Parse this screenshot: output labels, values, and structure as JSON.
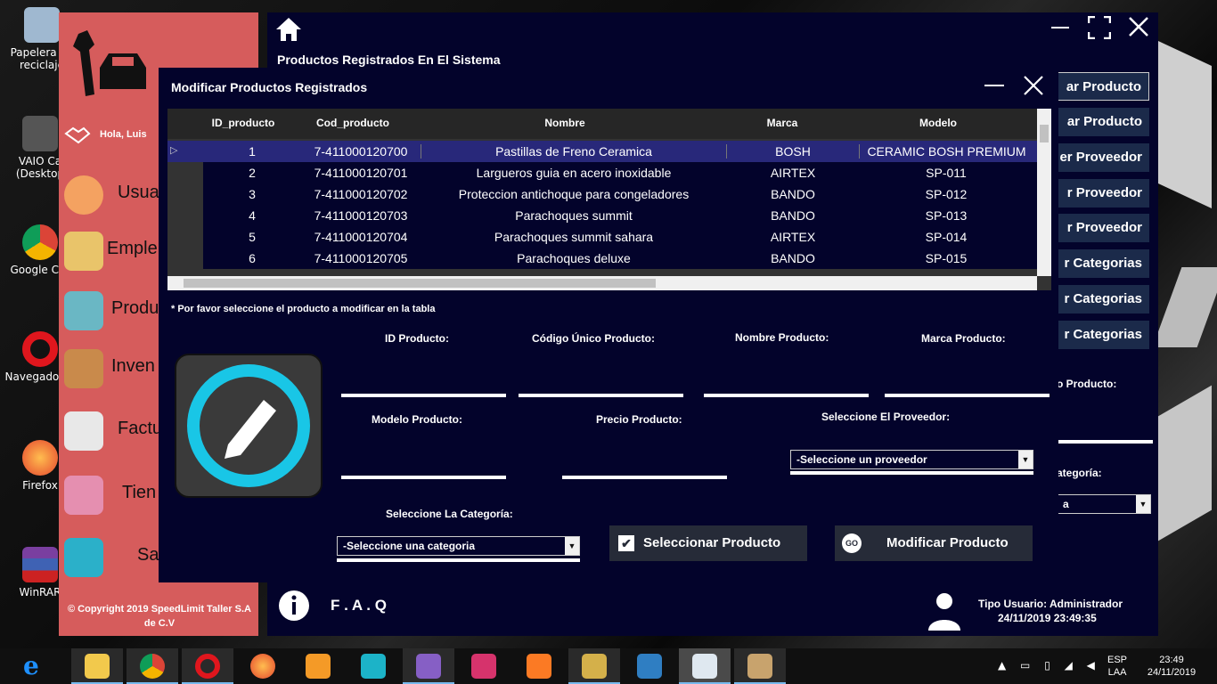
{
  "desktop_icons": [
    {
      "label": "Papelera de reciclaje",
      "icon": "recycle-bin-icon"
    },
    {
      "label": "VAIO Ca (Desktop",
      "icon": "vaio-laptop-icon"
    },
    {
      "label": "Google Chr",
      "icon": "chrome-icon"
    },
    {
      "label": "Navegador O",
      "icon": "opera-icon"
    },
    {
      "label": "Firefox",
      "icon": "firefox-icon"
    },
    {
      "label": "WinRAR",
      "icon": "winrar-icon"
    }
  ],
  "sidebar": {
    "greeting": "Hola, Luis",
    "items": [
      {
        "label": "Usua",
        "icon": "user-icon"
      },
      {
        "label": "Emple",
        "icon": "employee-badge-icon"
      },
      {
        "label": "Produ",
        "icon": "basket-icon"
      },
      {
        "label": "Inven",
        "icon": "box-icon"
      },
      {
        "label": "Factu",
        "icon": "cash-register-icon"
      },
      {
        "label": "Tien",
        "icon": "store-icon"
      },
      {
        "label": "Sa",
        "icon": "exit-icon"
      }
    ],
    "copyright": "© Copyright 2019 SpeedLimit Taller S.A de C.V"
  },
  "main": {
    "title": "Productos Registrados En El Sistema",
    "right_buttons": [
      "ar Producto",
      "ar Producto",
      "er Proveedor",
      "r Proveedor",
      "r Proveedor",
      "r Categorias",
      "r Categorias",
      "r Categorias"
    ],
    "partial_label_1": "o Producto:",
    "partial_label_2": "ategoría:",
    "partial_combo": "a",
    "faq": "F . A . Q",
    "user_type": "Tipo Usuario: Administrador",
    "datetime": "24/11/2019 23:49:35"
  },
  "dialog": {
    "title": "Modificar Productos Registrados",
    "columns": [
      "ID_producto",
      "Cod_producto",
      "Nombre",
      "Marca",
      "Modelo"
    ],
    "rows": [
      {
        "id": "1",
        "cod": "7-411000120700",
        "nombre": "Pastillas de Freno Ceramica",
        "marca": "BOSH",
        "modelo": "CERAMIC BOSH PREMIUM"
      },
      {
        "id": "2",
        "cod": "7-411000120701",
        "nombre": "Largueros guia en acero inoxidable",
        "marca": "AIRTEX",
        "modelo": "SP-011"
      },
      {
        "id": "3",
        "cod": "7-411000120702",
        "nombre": "Proteccion antichoque para congeladores",
        "marca": "BANDO",
        "modelo": "SP-012"
      },
      {
        "id": "4",
        "cod": "7-411000120703",
        "nombre": "Parachoques summit",
        "marca": "BANDO",
        "modelo": "SP-013"
      },
      {
        "id": "5",
        "cod": "7-411000120704",
        "nombre": "Parachoques summit sahara",
        "marca": "AIRTEX",
        "modelo": "SP-014"
      },
      {
        "id": "6",
        "cod": "7-411000120705",
        "nombre": "Parachoques deluxe",
        "marca": "BANDO",
        "modelo": "SP-015"
      }
    ],
    "hint": "* Por favor seleccione el producto a modificar en la tabla",
    "labels": {
      "id": "ID Producto:",
      "codigo": "Código Único Producto:",
      "nombre": "Nombre Producto:",
      "marca": "Marca Producto:",
      "modelo": "Modelo Producto:",
      "precio": "Precio Producto:",
      "proveedor": "Seleccione El Proveedor:",
      "categoria": "Seleccione La Categoría:"
    },
    "proveedor_value": "-Seleccione un proveedor",
    "categoria_value": "-Seleccione una categoria",
    "btn_select": "Seleccionar Producto",
    "btn_modify": "Modificar Producto",
    "btn_modify_badge": "GO"
  },
  "taskbar": {
    "lang": "ESP",
    "lang2": "LAA",
    "time": "23:49",
    "date": "24/11/2019"
  }
}
